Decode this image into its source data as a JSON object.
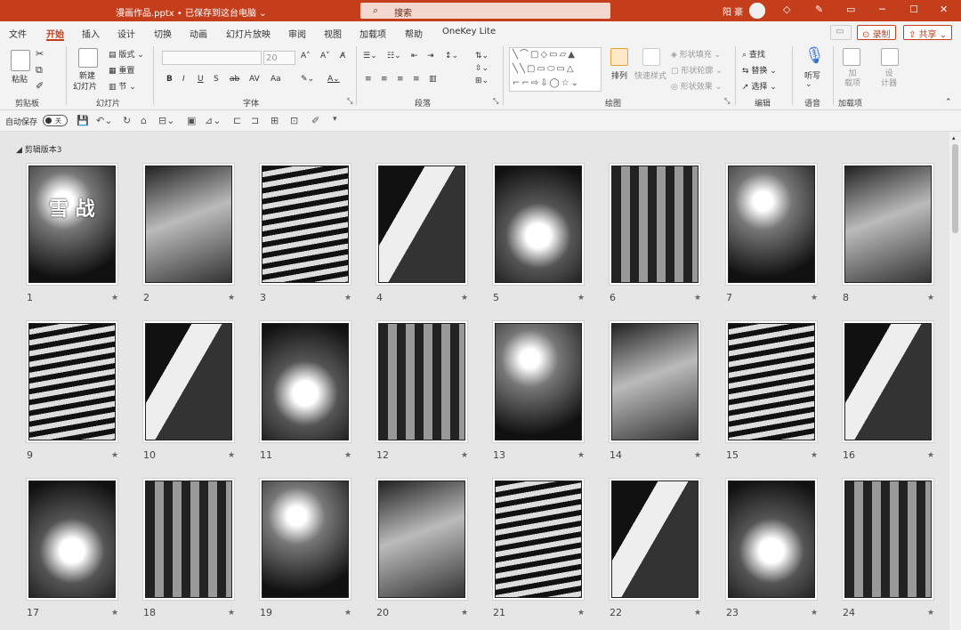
{
  "titlebar": {
    "file_title": "漫画作品.pptx • 已保存到这台电脑 ⌄",
    "search_placeholder": "搜索",
    "search_icon": "search-icon",
    "user_name": "阳 豪",
    "icons": [
      "diamond-icon",
      "pen-icon",
      "ribbon-display-icon",
      "minimize-icon",
      "maximize-icon",
      "close-icon"
    ]
  },
  "tabs": [
    "文件",
    "开始",
    "插入",
    "设计",
    "切换",
    "动画",
    "幻灯片放映",
    "审阅",
    "视图",
    "加载项",
    "帮助",
    "OneKey Lite"
  ],
  "active_tab": "开始",
  "ribbon_buttons": {
    "record": "录制",
    "share": "共享"
  },
  "ribbon": {
    "clipboard": {
      "label": "剪贴板",
      "paste": "粘贴"
    },
    "slides": {
      "label": "幻灯片",
      "new_slide": "新建",
      "new_slide2": "幻灯片",
      "layout": "版式",
      "reset": "重置",
      "section": "节"
    },
    "font": {
      "label": "字体",
      "size": "20",
      "bold": "B",
      "italic": "I",
      "underline": "U",
      "shadow": "S",
      "strike": "ab",
      "spacing": "AV",
      "case": "Aa"
    },
    "paragraph": {
      "label": "段落"
    },
    "drawing": {
      "label": "绘图",
      "arrange": "排列",
      "quick_styles": "快速样式",
      "shape_fill": "形状填充",
      "shape_outline": "形状轮廓",
      "shape_effects": "形状效果"
    },
    "editing": {
      "label": "编辑",
      "find": "查找",
      "replace": "替换",
      "select": "选择"
    },
    "voice": {
      "label": "语音",
      "dictate": "听写"
    },
    "addins": {
      "label": "加载项",
      "addins_btn": "加\n载项",
      "designer": "设\n计器"
    }
  },
  "qat": {
    "autosave": "自动保存",
    "toggle": "关"
  },
  "section_name": "剪辑版本3",
  "colors": {
    "brand": "#c43e1c",
    "ribbon_bg": "#f3f3f3",
    "workspace": "#e6e6e6"
  },
  "slides": [
    {
      "num": "1"
    },
    {
      "num": "2"
    },
    {
      "num": "3"
    },
    {
      "num": "4"
    },
    {
      "num": "5"
    },
    {
      "num": "6"
    },
    {
      "num": "7"
    },
    {
      "num": "8"
    },
    {
      "num": "9"
    },
    {
      "num": "10"
    },
    {
      "num": "11"
    },
    {
      "num": "12"
    },
    {
      "num": "13"
    },
    {
      "num": "14"
    },
    {
      "num": "15"
    },
    {
      "num": "16"
    },
    {
      "num": "17"
    },
    {
      "num": "18"
    },
    {
      "num": "19"
    },
    {
      "num": "20"
    },
    {
      "num": "21"
    },
    {
      "num": "22"
    },
    {
      "num": "23"
    },
    {
      "num": "24"
    }
  ],
  "slide_star_icon": "star-icon",
  "slide_star_glyph": "★",
  "slide1_title": "雪 战"
}
